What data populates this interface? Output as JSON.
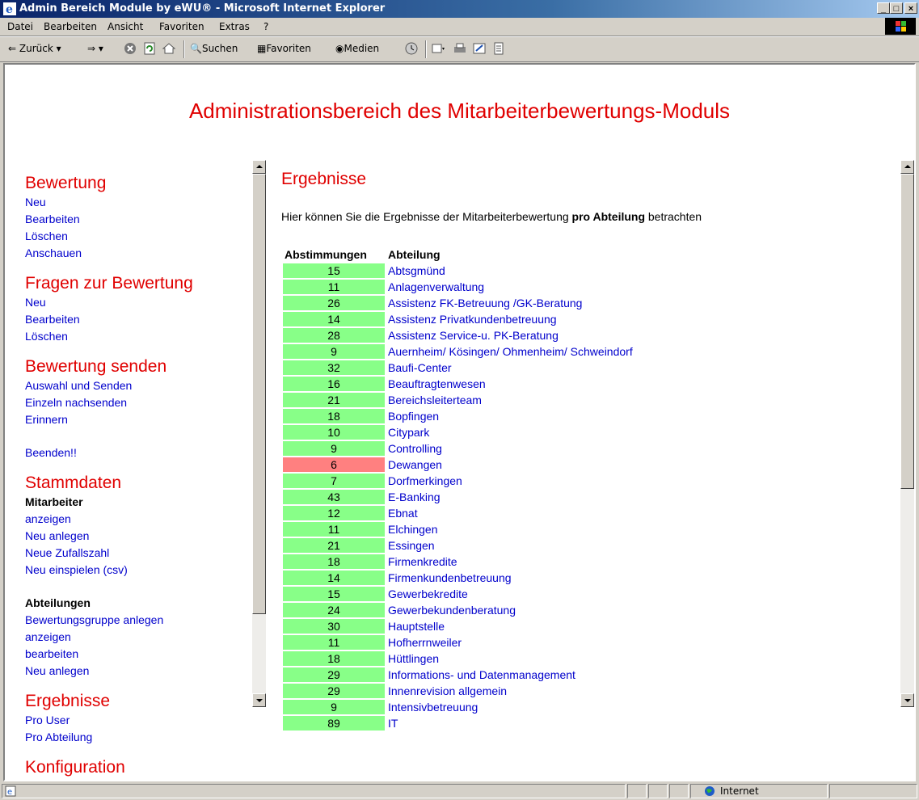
{
  "window": {
    "title": "Admin Bereich Module by eWU® - Microsoft Internet Explorer",
    "buttons": {
      "min": "_",
      "max": "□",
      "close": "×"
    }
  },
  "menu": {
    "items": [
      {
        "label": "Datei"
      },
      {
        "label": "Bearbeiten"
      },
      {
        "label": "Ansicht"
      },
      {
        "label": "Favoriten"
      },
      {
        "label": "Extras"
      },
      {
        "label": "?"
      }
    ]
  },
  "toolbar": {
    "back": "Zurück",
    "search": "Suchen",
    "favorites": "Favoriten",
    "media": "Medien"
  },
  "page": {
    "title": "Administrationsbereich des Mitarbeiterbewertungs-Moduls"
  },
  "nav": {
    "bewertung": {
      "heading": "Bewertung",
      "links": [
        "Neu",
        "Bearbeiten",
        "Löschen",
        "Anschauen"
      ]
    },
    "fragen": {
      "heading": "Fragen zur Bewertung",
      "links": [
        "Neu",
        "Bearbeiten",
        "Löschen"
      ]
    },
    "senden": {
      "heading": "Bewertung senden",
      "links": [
        "Auswahl und Senden",
        "Einzeln nachsenden",
        "Erinnern"
      ]
    },
    "beenden": "Beenden!!",
    "stammdaten": {
      "heading": "Stammdaten",
      "mitarbeiter": {
        "label": "Mitarbeiter",
        "links": [
          "anzeigen",
          "Neu anlegen",
          "Neue Zufallszahl",
          "Neu einspielen (csv)"
        ]
      },
      "abteilungen": {
        "label": "Abteilungen",
        "links": [
          "Bewertungsgruppe anlegen",
          "anzeigen",
          "bearbeiten",
          "Neu anlegen"
        ]
      }
    },
    "ergebnisse": {
      "heading": "Ergebnisse",
      "links": [
        "Pro User",
        "Pro Abteilung"
      ]
    },
    "konfiguration": {
      "heading": "Konfiguration"
    }
  },
  "results": {
    "heading": "Ergebnisse",
    "intro_before": "Hier können Sie die Ergebnisse der Mitarbeiterbewertung ",
    "intro_bold": "pro Abteilung",
    "intro_after": " betrachten",
    "col_votes": "Abstimmungen",
    "col_dept": "Abteilung",
    "color_ok": "#88ff88",
    "color_low": "#ff8080",
    "rows": [
      {
        "votes": "15",
        "dept": "Abtsgmünd",
        "low": false
      },
      {
        "votes": "11",
        "dept": "Anlagenverwaltung",
        "low": false
      },
      {
        "votes": "26",
        "dept": "Assistenz FK-Betreuung /GK-Beratung",
        "low": false
      },
      {
        "votes": "14",
        "dept": "Assistenz Privatkundenbetreuung",
        "low": false
      },
      {
        "votes": "28",
        "dept": "Assistenz Service-u. PK-Beratung",
        "low": false
      },
      {
        "votes": "9",
        "dept": "Auernheim/ Kösingen/ Ohmenheim/ Schweindorf",
        "low": false
      },
      {
        "votes": "32",
        "dept": "Baufi-Center",
        "low": false
      },
      {
        "votes": "16",
        "dept": "Beauftragtenwesen",
        "low": false
      },
      {
        "votes": "21",
        "dept": "Bereichsleiterteam",
        "low": false
      },
      {
        "votes": "18",
        "dept": "Bopfingen",
        "low": false
      },
      {
        "votes": "10",
        "dept": "Citypark",
        "low": false
      },
      {
        "votes": "9",
        "dept": "Controlling",
        "low": false
      },
      {
        "votes": "6",
        "dept": "Dewangen",
        "low": true
      },
      {
        "votes": "7",
        "dept": "Dorfmerkingen",
        "low": false
      },
      {
        "votes": "43",
        "dept": "E-Banking",
        "low": false
      },
      {
        "votes": "12",
        "dept": "Ebnat",
        "low": false
      },
      {
        "votes": "11",
        "dept": "Elchingen",
        "low": false
      },
      {
        "votes": "21",
        "dept": "Essingen",
        "low": false
      },
      {
        "votes": "18",
        "dept": "Firmenkredite",
        "low": false
      },
      {
        "votes": "14",
        "dept": "Firmenkundenbetreuung",
        "low": false
      },
      {
        "votes": "15",
        "dept": "Gewerbekredite",
        "low": false
      },
      {
        "votes": "24",
        "dept": "Gewerbekundenberatung",
        "low": false
      },
      {
        "votes": "30",
        "dept": "Hauptstelle",
        "low": false
      },
      {
        "votes": "11",
        "dept": "Hofherrnweiler",
        "low": false
      },
      {
        "votes": "18",
        "dept": "Hüttlingen",
        "low": false
      },
      {
        "votes": "29",
        "dept": "Informations- und Datenmanagement",
        "low": false
      },
      {
        "votes": "29",
        "dept": "Innenrevision allgemein",
        "low": false
      },
      {
        "votes": "9",
        "dept": "Intensivbetreuung",
        "low": false
      },
      {
        "votes": "89",
        "dept": "IT",
        "low": false
      }
    ]
  },
  "status": {
    "zone": "Internet"
  }
}
